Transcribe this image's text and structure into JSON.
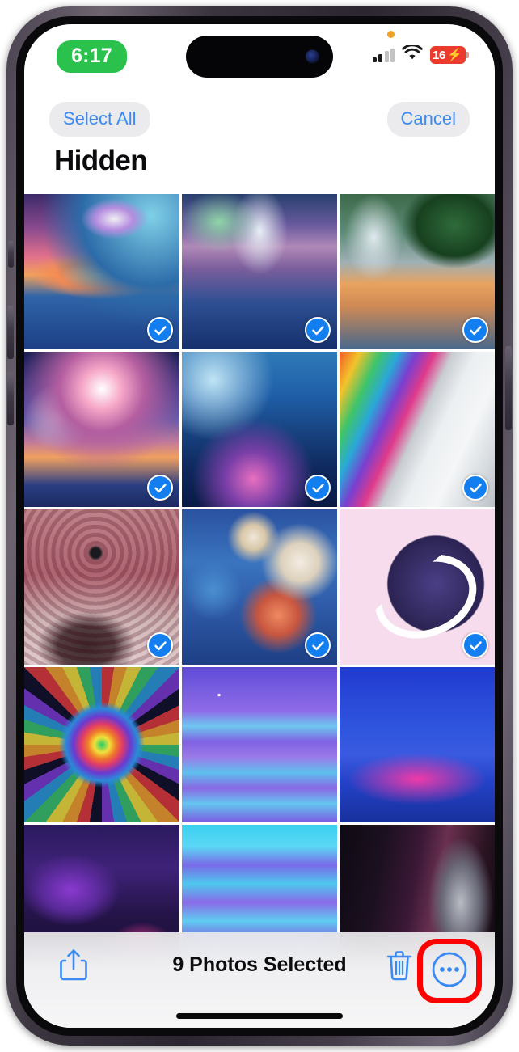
{
  "device": {
    "name": "iphone-14-pro",
    "frame_color": "#3a343f"
  },
  "status_bar": {
    "time": "6:17",
    "time_pill_color": "#2ac14d",
    "privacy_indicator": "orange-dot",
    "cellular_icon": "cellular-bars-icon",
    "wifi_icon": "wifi-icon",
    "battery_level": "16",
    "battery_color": "#ec3b2e",
    "charging": true,
    "charging_icon": "⚡"
  },
  "nav_bar": {
    "select_all_label": "Select All",
    "cancel_label": "Cancel",
    "title": "Hidden",
    "accent_color": "#3a8af5",
    "pill_background": "#ebebed"
  },
  "toolbar": {
    "share_icon": "share-icon",
    "selection_status": "9 Photos Selected",
    "delete_icon": "trash-icon",
    "more_icon": "ellipsis-circle-icon",
    "highlight_color": "#fe0000",
    "highlighted_control": "more-button"
  },
  "grid": {
    "columns": 3,
    "selected_count": 9,
    "check_color": "#137ef0",
    "photos": [
      {
        "id": "photo-1",
        "art": "a1",
        "description": "cosmic-ocean-sunset-planets",
        "selected": true
      },
      {
        "id": "photo-2",
        "art": "a2",
        "description": "waterfall-whale-fantasy",
        "selected": true
      },
      {
        "id": "photo-3",
        "art": "a3",
        "description": "jungle-waterfall-dolphins",
        "selected": true
      },
      {
        "id": "photo-4",
        "art": "a4",
        "description": "dolphin-galaxy-sunset",
        "selected": true
      },
      {
        "id": "photo-5",
        "art": "a5",
        "description": "orcas-underwater-cosmos",
        "selected": true
      },
      {
        "id": "photo-6",
        "art": "a6",
        "description": "psychedelic-mushroom-ladder",
        "selected": true
      },
      {
        "id": "photo-7",
        "art": "a7",
        "description": "red-mandala-mountain",
        "selected": true
      },
      {
        "id": "photo-8",
        "art": "a8",
        "description": "saturn-planets-collage",
        "selected": true
      },
      {
        "id": "photo-9",
        "art": "a9",
        "description": "pink-ringed-planet",
        "selected": true
      },
      {
        "id": "photo-10",
        "art": "a10",
        "description": "rainbow-flower-of-life",
        "selected": false
      },
      {
        "id": "photo-11",
        "art": "a11",
        "description": "purple-constellation-clouds",
        "selected": false
      },
      {
        "id": "photo-12",
        "art": "a12",
        "description": "blue-saturn-sketch",
        "selected": false
      },
      {
        "id": "photo-13",
        "art": "a13",
        "description": "crescent-moon-nebula",
        "selected": false
      },
      {
        "id": "photo-14",
        "art": "a14",
        "description": "cyan-purple-cloud-sky",
        "selected": false
      },
      {
        "id": "photo-15",
        "art": "a15",
        "description": "dark-canyon-moody",
        "selected": false
      }
    ]
  }
}
